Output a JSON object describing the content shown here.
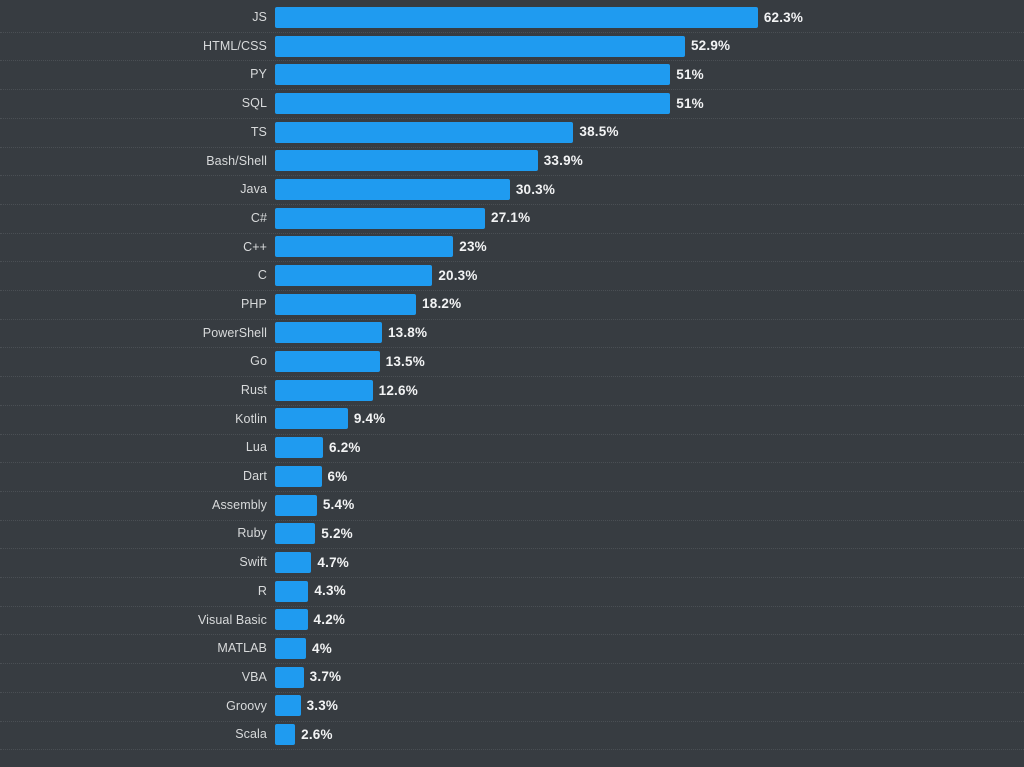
{
  "chart_data": {
    "type": "bar",
    "orientation": "horizontal",
    "title": "",
    "subtitle": "",
    "xlabel": "",
    "ylabel": "",
    "xlim": [
      0,
      62.3
    ],
    "grid": true,
    "legend": false,
    "legend_position": "none",
    "colors": {
      "background": "#373c41",
      "bar": "#1f9bf0",
      "category_label": "#d8dadb",
      "value_label": "#f2f3f4",
      "gridline": "#4a4f54"
    },
    "value_suffix": "%",
    "categories": [
      "JS",
      "HTML/CSS",
      "PY",
      "SQL",
      "TS",
      "Bash/Shell",
      "Java",
      "C#",
      "C++",
      "C",
      "PHP",
      "PowerShell",
      "Go",
      "Rust",
      "Kotlin",
      "Lua",
      "Dart",
      "Assembly",
      "Ruby",
      "Swift",
      "R",
      "Visual Basic",
      "MATLAB",
      "VBA",
      "Groovy",
      "Scala"
    ],
    "values": [
      62.3,
      52.9,
      51,
      51,
      38.5,
      33.9,
      30.3,
      27.1,
      23,
      20.3,
      18.2,
      13.8,
      13.5,
      12.6,
      9.4,
      6.2,
      6,
      5.4,
      5.2,
      4.7,
      4.3,
      4.2,
      4,
      3.7,
      3.3,
      2.6
    ],
    "value_labels": [
      "62.3%",
      "52.9%",
      "51%",
      "51%",
      "38.5%",
      "33.9%",
      "30.3%",
      "27.1%",
      "23%",
      "20.3%",
      "18.2%",
      "13.8%",
      "13.5%",
      "12.6%",
      "9.4%",
      "6.2%",
      "6%",
      "5.4%",
      "5.2%",
      "4.7%",
      "4.3%",
      "4.2%",
      "4%",
      "3.7%",
      "3.3%",
      "2.6%"
    ]
  }
}
